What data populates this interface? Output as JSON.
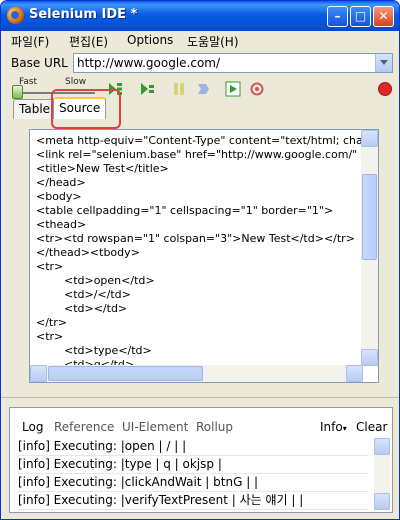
{
  "window": {
    "title": "Selenium IDE *"
  },
  "menu": [
    {
      "label": "파일(F)"
    },
    {
      "label": "편집(E)"
    },
    {
      "label": "Options"
    },
    {
      "label": "도움말(H)"
    }
  ],
  "base_url": {
    "label": "Base URL",
    "value": "http://www.google.com/"
  },
  "speed": {
    "fast_label": "Fast",
    "slow_label": "Slow",
    "level": 0
  },
  "tabs": [
    {
      "label": "Table",
      "active": false
    },
    {
      "label": "Source",
      "active": true
    }
  ],
  "source_lines": [
    "<meta http-equiv=\"Content-Type\" content=\"text/html; chars",
    "<link rel=\"selenium.base\" href=\"http://www.google.com/\" /",
    "<title>New Test</title>",
    "</head>",
    "<body>",
    "<table cellpadding=\"1\" cellspacing=\"1\" border=\"1\">",
    "<thead>",
    "<tr><td rowspan=\"1\" colspan=\"3\">New Test</td></tr>",
    "</thead><tbody>",
    "<tr>",
    "        <td>open</td>",
    "        <td>/</td>",
    "        <td></td>",
    "</tr>",
    "<tr>",
    "        <td>type</td>",
    "        <td>q</td>"
  ],
  "log_panel": {
    "tabs": [
      "Log",
      "Reference",
      "UI-Element",
      "Rollup"
    ],
    "info_label": "Info",
    "clear_label": "Clear",
    "lines": [
      "[info] Executing: |open | / | |",
      "[info] Executing: |type | q | okjsp |",
      "[info] Executing: |clickAndWait | btnG | |",
      "[info] Executing: |verifyTextPresent | 사는 얘기 | |"
    ]
  },
  "colors": {
    "titlebar": "#0153d8",
    "window_bg": "#ece9d8",
    "active_tab_accent": "#ffc83c",
    "highlight": "#e04040",
    "record": "#e02828",
    "play": "#2e9e2e"
  }
}
